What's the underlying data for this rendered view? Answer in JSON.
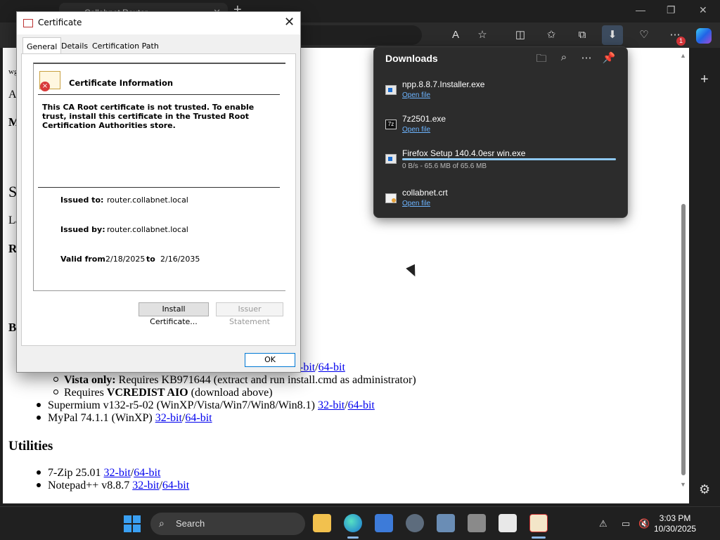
{
  "browser": {
    "tab_title": "Collabnet Router",
    "notification_count": "1"
  },
  "page": {
    "frag_wg": "wg",
    "frag_a": "A",
    "frag_m": "M",
    "frag_s": "S",
    "frag_la": "La",
    "frag_r": "R",
    "frag_b": "B",
    "link_32": "32-bit",
    "link_64": "64-bit",
    "sub_vista_bold": "Vista only:",
    "sub_vista_rest": " Requires KB971644 (extract and run install.cmd as administrator)",
    "sub_requires": "Requires ",
    "sub_vcredist": "VCREDIST AIO",
    "sub_vcredist_rest": " (download above)",
    "supermium": "Supermium v132-r5-02 (WinXP/Vista/Win7/Win8/Win8.1) ",
    "mypal": "MyPal 74.1.1 (WinXP) ",
    "utilities_heading": "Utilities",
    "sevenzip": "7-Zip 25.01 ",
    "notepad": "Notepad++ v8.8.7 ",
    "slash": "/"
  },
  "downloads": {
    "title": "Downloads",
    "items": [
      {
        "name": "npp.8.8.7.Installer.exe",
        "action": "Open file"
      },
      {
        "name": "7z2501.exe",
        "action": "Open file"
      },
      {
        "name": "Firefox Setup 140.4.0esr win.exe",
        "status": "0 B/s - 65.6 MB of 65.6 MB",
        "progress": 1.0
      },
      {
        "name": "collabnet.crt",
        "action": "Open file"
      }
    ]
  },
  "certificate": {
    "window_title": "Certificate",
    "tabs": [
      "General",
      "Details",
      "Certification Path"
    ],
    "info_title": "Certificate Information",
    "warning": "This CA Root certificate is not trusted. To enable trust, install this certificate in the Trusted Root Certification Authorities store.",
    "issued_to_label": "Issued to:",
    "issued_to": "router.collabnet.local",
    "issued_by_label": "Issued by:",
    "issued_by": "router.collabnet.local",
    "valid_from_label": "Valid from",
    "valid_from": "2/18/2025",
    "to_label": "to",
    "valid_to": "2/16/2035",
    "install_button": "Install Certificate...",
    "issuer_button": "Issuer Statement",
    "ok_button": "OK"
  },
  "taskbar": {
    "search_label": "Search",
    "time": "3:03 PM",
    "date": "10/30/2025"
  },
  "colors": {
    "accent": "#0078d4",
    "link": "#0000ee",
    "dl_link": "#6cb4ff"
  }
}
